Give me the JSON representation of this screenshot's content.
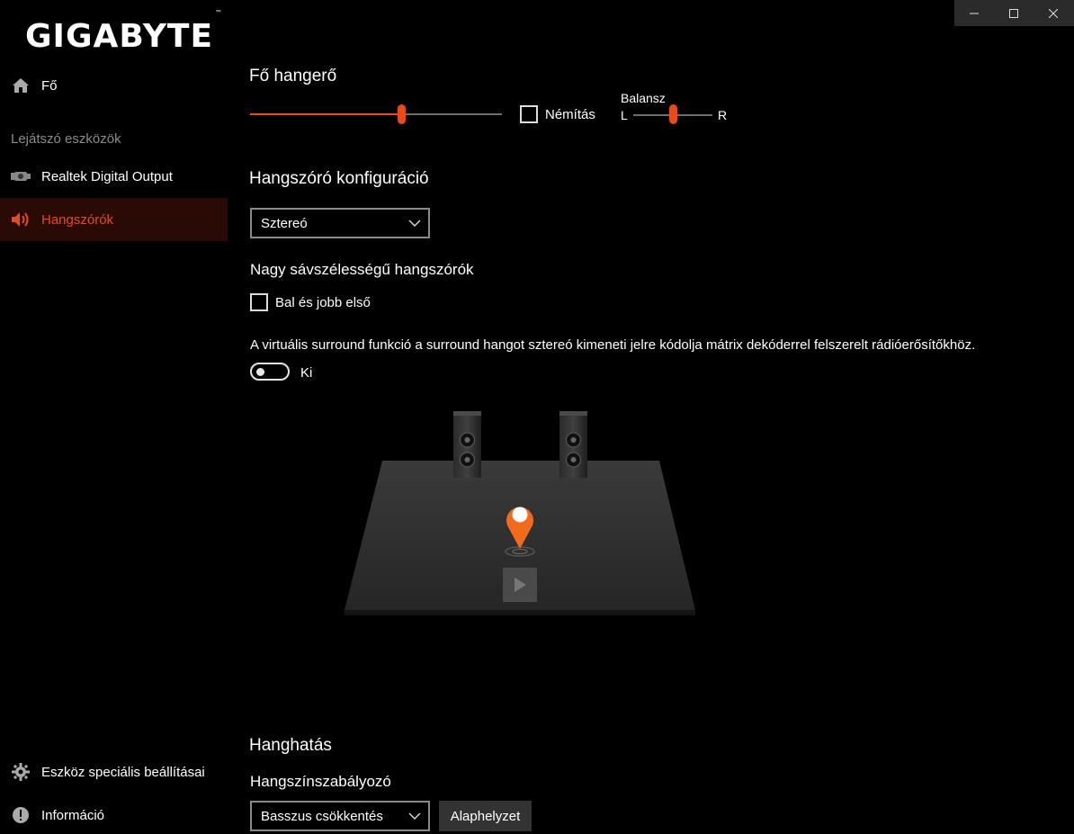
{
  "window": {
    "minimize_icon": "minimize-icon",
    "maximize_icon": "maximize-icon",
    "close_icon": "close-icon"
  },
  "brand": {
    "logo_text": "GIGABYTE",
    "trademark": "™"
  },
  "sidebar": {
    "home": {
      "label": "Fő",
      "icon": "home-icon"
    },
    "section_label": "Lejátszó eszközök",
    "devices": [
      {
        "label": "Realtek Digital Output",
        "icon": "digital-output-icon",
        "active": false
      },
      {
        "label": "Hangszórók",
        "icon": "speaker-icon",
        "active": true
      }
    ],
    "bottom": [
      {
        "label": "Eszköz speciális beállításai",
        "icon": "gear-icon"
      },
      {
        "label": "Információ",
        "icon": "info-icon"
      }
    ]
  },
  "main": {
    "master_volume": {
      "title": "Fő hangerő",
      "level": 0.6,
      "mute_label": "Némítás",
      "mute_checked": false,
      "balance_label": "Balansz",
      "balance_left": "L",
      "balance_right": "R",
      "balance_level": 0.5
    },
    "speaker_config": {
      "title": "Hangszóró konfiguráció",
      "selected": "Sztereó"
    },
    "fullrange": {
      "title": "Nagy sávszélességű hangszórók",
      "checkbox_label": "Bal és jobb első",
      "checked": false
    },
    "virtual_surround": {
      "description": "A virtuális surround funkció a surround hangot sztereó kimeneti jelre kódolja mátrix dekóderrel felszerelt rádióerősítőkhöz.",
      "toggle_state": "Ki"
    },
    "sound_effect": {
      "title": "Hanghatás",
      "eq_label": "Hangszínszabályozó",
      "eq_selected": "Basszus csökkentés",
      "reset_label": "Alaphelyzet"
    }
  },
  "colors": {
    "accent": "#e84a1c",
    "pin": "#f26b1d",
    "active_bg": "#2a0a05"
  }
}
